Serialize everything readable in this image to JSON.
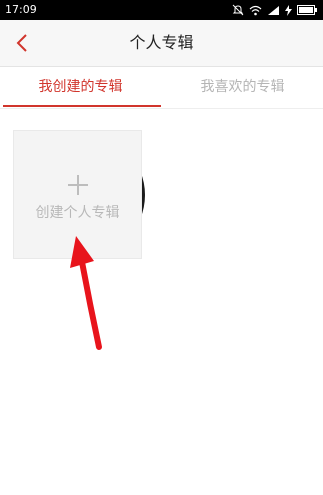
{
  "status_bar": {
    "time": "17:09",
    "icons": [
      "mute-icon",
      "wifi-icon",
      "signal-icon",
      "charging-icon",
      "battery-icon"
    ]
  },
  "nav": {
    "title": "个人专辑",
    "back_icon": "chevron-left-icon"
  },
  "tabs": [
    {
      "label": "我创建的专辑",
      "active": true
    },
    {
      "label": "我喜欢的专辑",
      "active": false
    }
  ],
  "create_album_card": {
    "icon": "plus-icon",
    "label": "创建个人专辑"
  },
  "colors": {
    "accent": "#d1352c",
    "annotation_arrow": "#e8141c",
    "inactive_tab": "#b5b5b5",
    "card_background": "#f4f4f4",
    "card_text": "#b8b8b8"
  }
}
